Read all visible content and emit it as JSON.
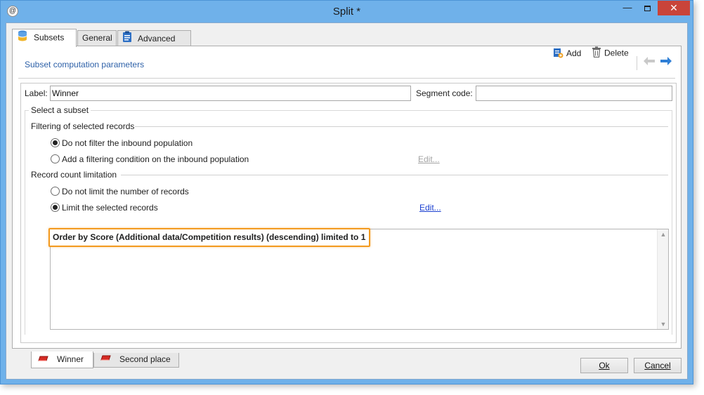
{
  "window": {
    "app_icon": "app-logo-icon",
    "title": "Split *",
    "minimize_glyph": "—",
    "close_glyph": "✕"
  },
  "tabs": [
    {
      "label": "Subsets",
      "icon": "database-icon"
    },
    {
      "label": "General"
    },
    {
      "label": "Advanced",
      "icon": "clipboard-icon"
    }
  ],
  "section": {
    "title": "Subset computation parameters"
  },
  "toolbar": {
    "add_label": "Add",
    "delete_label": "Delete"
  },
  "form": {
    "label_caption": "Label:",
    "label_value": "Winner",
    "segment_caption": "Segment code:",
    "segment_value": ""
  },
  "subset_group": {
    "title": "Select a subset"
  },
  "filtering": {
    "title": "Filtering of selected records",
    "options": [
      {
        "label": "Do not filter the inbound population",
        "checked": true
      },
      {
        "label": "Add a filtering condition on the inbound population",
        "checked": false
      }
    ],
    "edit_label": "Edit..."
  },
  "limitation": {
    "title": "Record count limitation",
    "options": [
      {
        "label": "Do not limit the number of records",
        "checked": false
      },
      {
        "label": "Limit the selected records",
        "checked": true
      }
    ],
    "edit_label": "Edit..."
  },
  "query": {
    "text": "Order by Score (Additional data/Competition results) (descending) limited to 1"
  },
  "subset_tabs": [
    {
      "label": "Winner",
      "icon": "subset-icon"
    },
    {
      "label": "Second place",
      "icon": "subset-icon"
    }
  ],
  "buttons": {
    "ok_label": "Ok",
    "cancel_label": "Cancel"
  },
  "colors": {
    "title_bar": "#6fb1ea",
    "close_button": "#c9443a",
    "section_title": "#2e61a8",
    "highlight_border": "#f39a1f",
    "link": "#1a3fd0"
  }
}
